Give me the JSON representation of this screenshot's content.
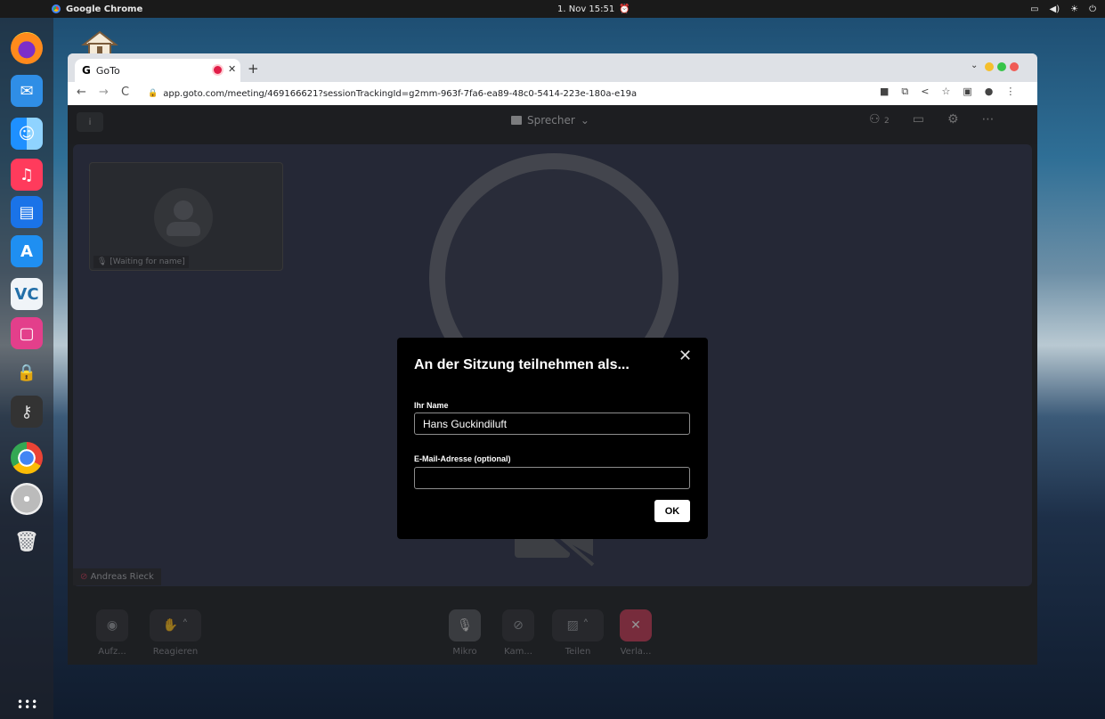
{
  "system_bar": {
    "app_name": "Google Chrome",
    "clock": "1. Nov  15:51"
  },
  "browser": {
    "tab_title": "GoTo",
    "tab_logo": "G",
    "url": "app.goto.com/meeting/469166621?sessionTrackingId=g2mm-963f-7fa6-ea89-48c0-5414-223e-180a-e19a"
  },
  "meeting": {
    "layout_label": "Sprecher",
    "participant_count": "2",
    "thumbnail_name": "[Waiting for name]",
    "speaker_name": "Andreas Rieck",
    "controls": {
      "record": "Aufz...",
      "react": "Reagieren",
      "mic": "Mikro",
      "camera": "Kam...",
      "share": "Teilen",
      "leave": "Verla..."
    }
  },
  "dialog": {
    "title": "An der Sitzung teilnehmen als...",
    "name_label": "Ihr Name",
    "name_value": "Hans Guckindiluft",
    "email_label": "E-Mail-Adresse (optional)",
    "email_value": "",
    "ok_label": "OK"
  }
}
